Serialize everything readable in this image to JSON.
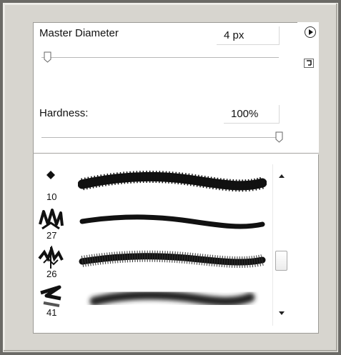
{
  "master_diameter": {
    "label": "Master Diameter",
    "value": "4 px",
    "level": 0.02
  },
  "hardness": {
    "label": "Hardness:",
    "value": "100%",
    "level": 1.0
  },
  "brushes": [
    {
      "size": "10",
      "icon": "diamond-icon",
      "stroke": "spiky-stroke"
    },
    {
      "size": "27",
      "icon": "zigzag-icon",
      "stroke": "thin-stroke"
    },
    {
      "size": "26",
      "icon": "spiky-cluster-icon",
      "stroke": "hatched-stroke"
    },
    {
      "size": "41",
      "icon": "swoosh-icon",
      "stroke": "soft-blur-stroke"
    }
  ],
  "colors": {
    "panel": "#ffffff",
    "frame": "#d7d5cf",
    "ink": "#111111"
  }
}
